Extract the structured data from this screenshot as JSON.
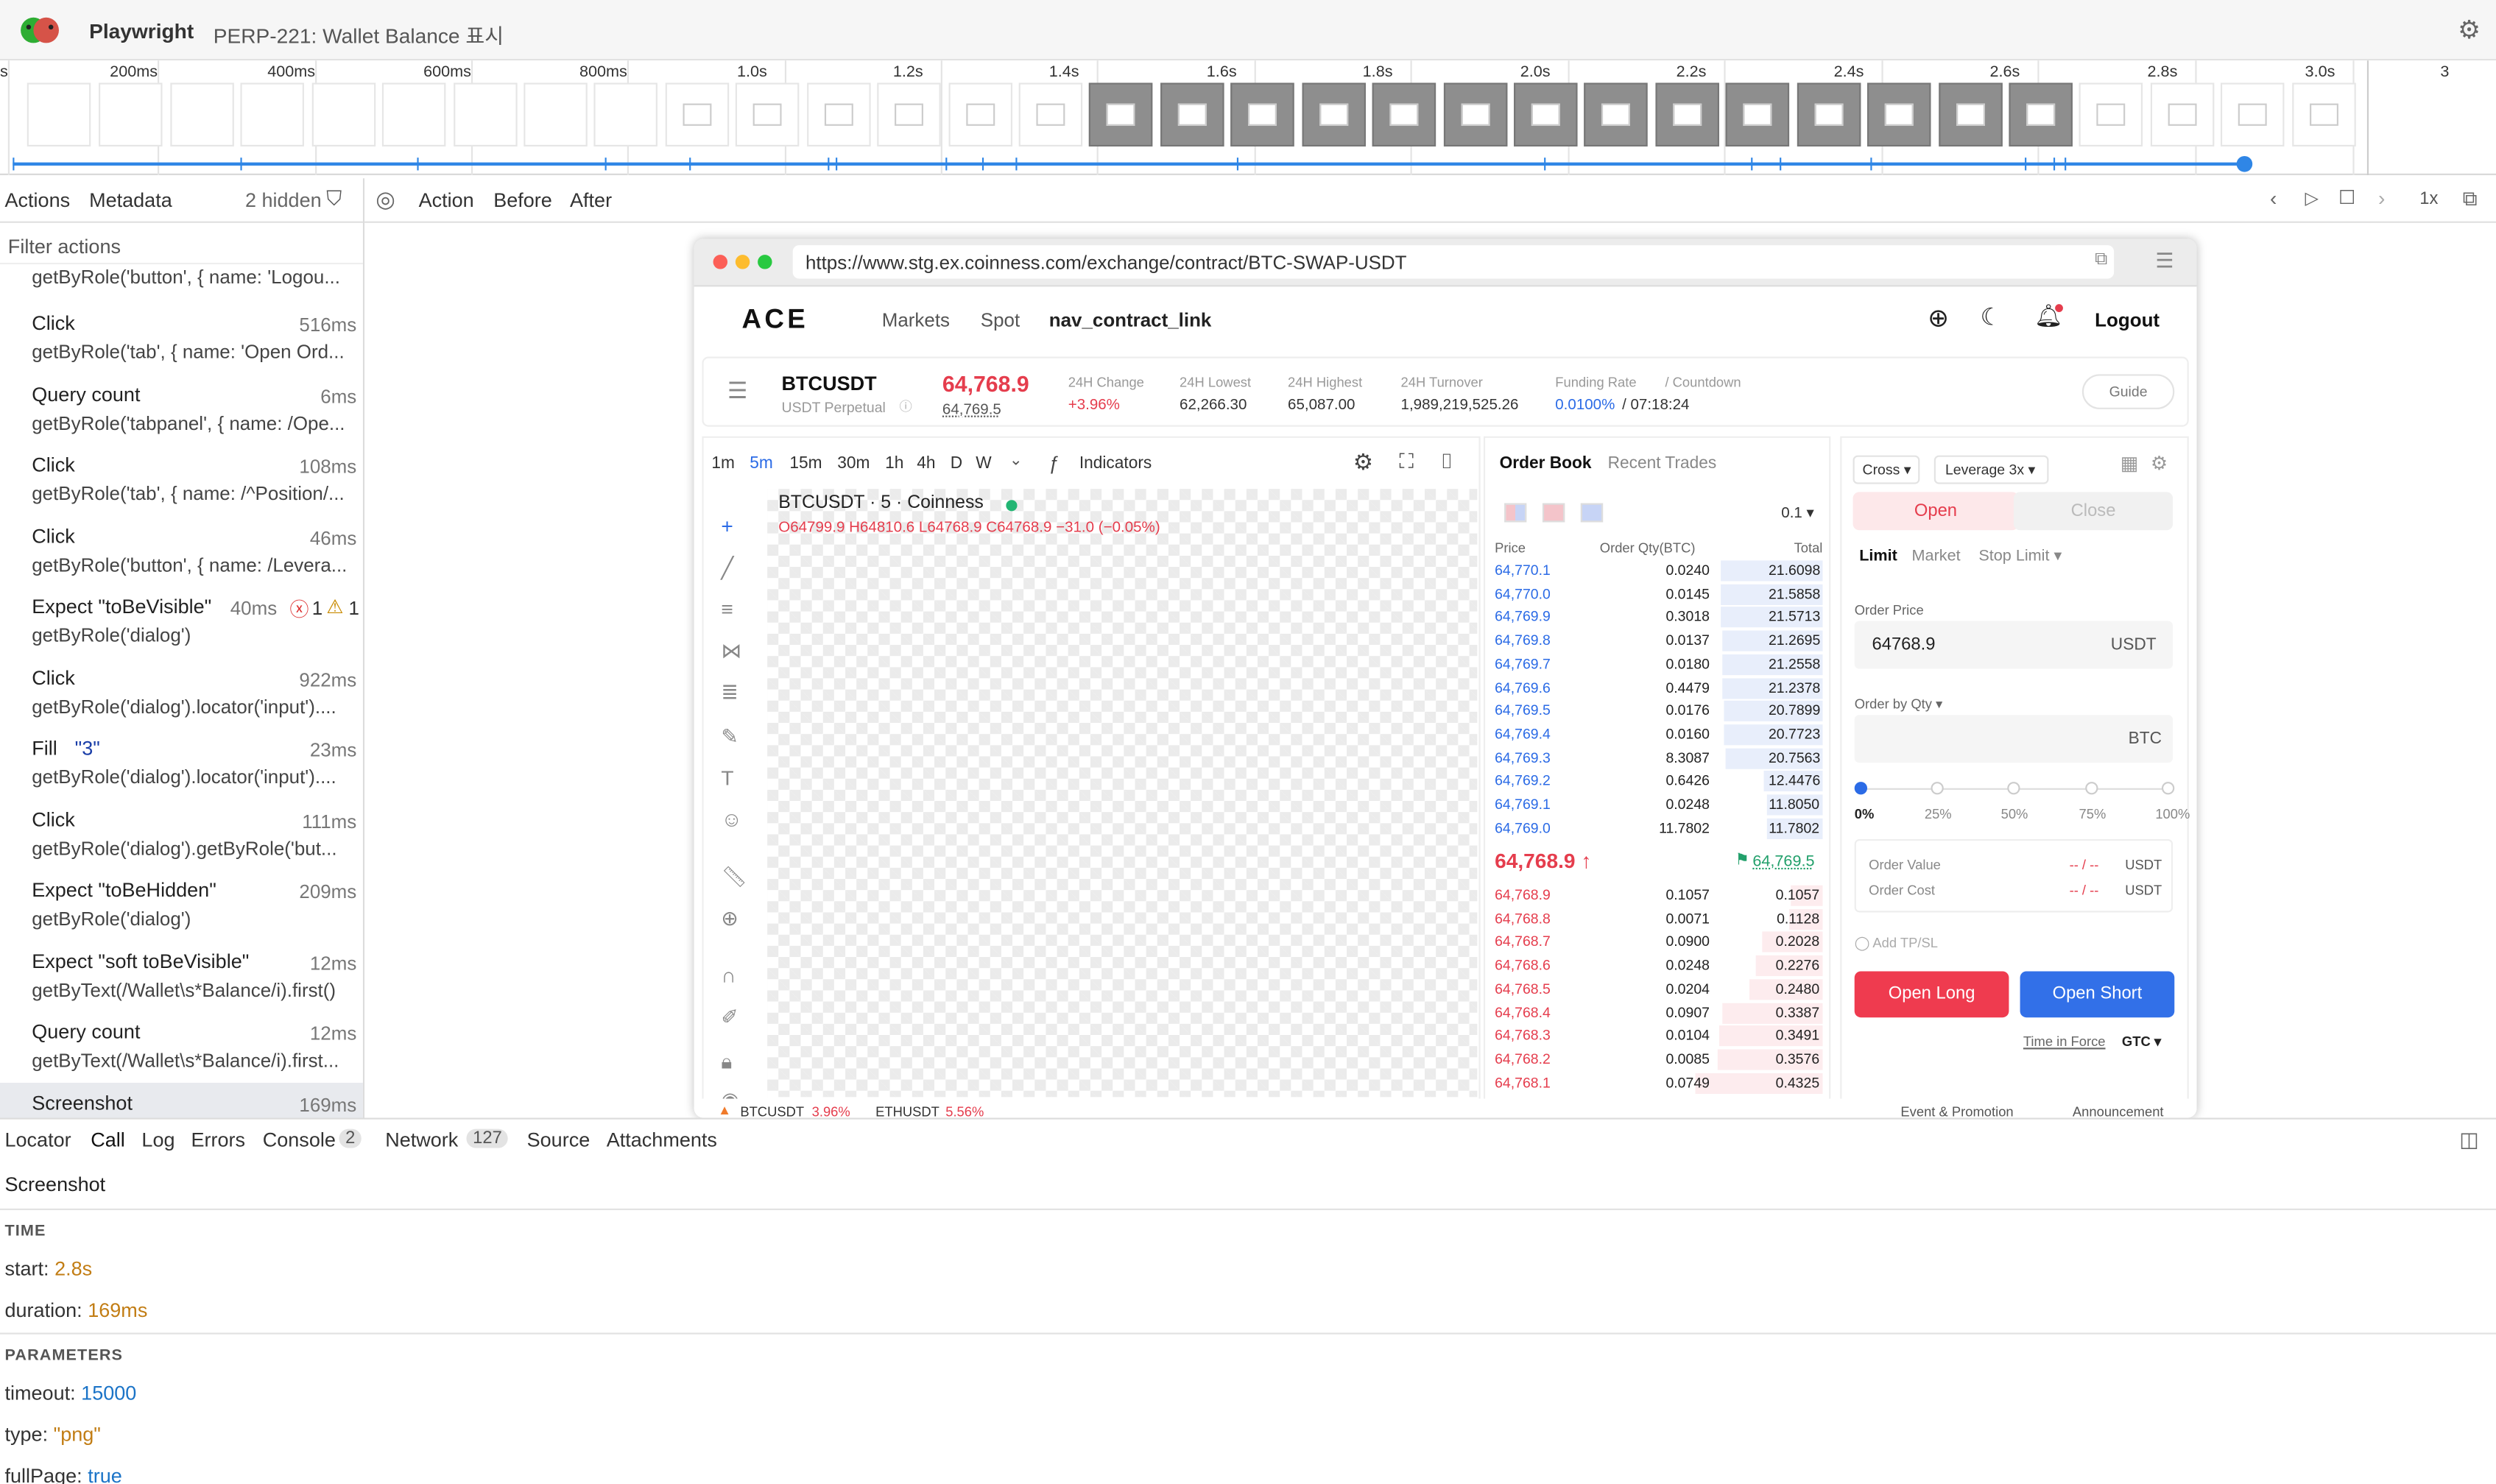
{
  "app": {
    "name": "Playwright",
    "title": "PERP-221: Wallet Balance 표시"
  },
  "timeline": {
    "labels": [
      "s",
      "200ms",
      "400ms",
      "600ms",
      "800ms",
      "1.0s",
      "1.2s",
      "1.4s",
      "1.6s",
      "1.8s",
      "2.0s",
      "2.2s",
      "2.4s",
      "2.6s",
      "2.8s",
      "3.0s",
      "3"
    ]
  },
  "sidebar": {
    "tabs": {
      "actions": "Actions",
      "metadata": "Metadata",
      "hidden": "2 hidden"
    },
    "filter_placeholder": "Filter actions",
    "first_sub": "getByRole('button', { name: 'Logou...",
    "actions": [
      {
        "title": "Click",
        "duration": "516ms",
        "sub": "getByRole('tab', { name: 'Open Ord..."
      },
      {
        "title": "Query count",
        "duration": "6ms",
        "sub": "getByRole('tabpanel', { name: /Ope..."
      },
      {
        "title": "Click",
        "duration": "108ms",
        "sub": "getByRole('tab', { name: /^Position/..."
      },
      {
        "title": "Click",
        "duration": "46ms",
        "sub": "getByRole('button', { name: /Levera..."
      },
      {
        "title": "Expect \"toBeVisible\"",
        "duration": "40ms",
        "sub": "getByRole('dialog')",
        "errors": "1",
        "warnings": "1"
      },
      {
        "title": "Click",
        "duration": "922ms",
        "sub": "getByRole('dialog').locator('input')...."
      },
      {
        "title": "Fill",
        "title_value": "\"3\"",
        "duration": "23ms",
        "sub": "getByRole('dialog').locator('input')...."
      },
      {
        "title": "Click",
        "duration": "111ms",
        "sub": "getByRole('dialog').getByRole('but..."
      },
      {
        "title": "Expect \"toBeHidden\"",
        "duration": "209ms",
        "sub": "getByRole('dialog')"
      },
      {
        "title": "Expect \"soft toBeVisible\"",
        "duration": "12ms",
        "sub": "getByText(/Wallet\\s*Balance/i).first()"
      },
      {
        "title": "Query count",
        "duration": "12ms",
        "sub": "getByText(/Wallet\\s*Balance/i).first..."
      },
      {
        "title": "Screenshot",
        "duration": "169ms",
        "sub": ""
      }
    ]
  },
  "snapshot_tabs": {
    "action": "Action",
    "before": "Before",
    "after": "After",
    "speed": "1x"
  },
  "browser": {
    "url": "https://www.stg.ex.coinness.com/exchange/contract/BTC-SWAP-USDT",
    "nav": {
      "logo": "ACE",
      "markets": "Markets",
      "spot": "Spot",
      "contract": "nav_contract_link",
      "logout": "Logout"
    },
    "ticker": {
      "symbol": "BTCUSDT",
      "type": "USDT Perpetual",
      "price": "64,768.9",
      "mark": "64,769.5",
      "change_label": "24H Change",
      "change": "+3.96%",
      "low_label": "24H Lowest",
      "low": "62,266.30",
      "high_label": "24H Highest",
      "high": "65,087.00",
      "turnover_label": "24H Turnover",
      "turnover": "1,989,219,525.26",
      "funding_label": "Funding Rate",
      "countdown_label": "/ Countdown",
      "funding": "0.0100%",
      "countdown": "/ 07:18:24",
      "guide": "Guide"
    },
    "chart": {
      "intervals": [
        "1m",
        "5m",
        "15m",
        "30m",
        "1h",
        "4h",
        "D",
        "W"
      ],
      "indicators": "Indicators",
      "legend_title": "BTCUSDT · 5 · Coinness",
      "ohlc": "O64799.9 H64810.6 L64768.9 C64768.9 −31.0 (−0.05%)"
    },
    "orderbook": {
      "tab_book": "Order Book",
      "tab_trades": "Recent Trades",
      "precision": "0.1",
      "col_price": "Price",
      "col_qty": "Order Qty(BTC)",
      "col_total": "Total",
      "asks": [
        [
          "64,770.1",
          "0.0240",
          "21.6098"
        ],
        [
          "64,770.0",
          "0.0145",
          "21.5858"
        ],
        [
          "64,769.9",
          "0.3018",
          "21.5713"
        ],
        [
          "64,769.8",
          "0.0137",
          "21.2695"
        ],
        [
          "64,769.7",
          "0.0180",
          "21.2558"
        ],
        [
          "64,769.6",
          "0.4479",
          "21.2378"
        ],
        [
          "64,769.5",
          "0.0176",
          "20.7899"
        ],
        [
          "64,769.4",
          "0.0160",
          "20.7723"
        ],
        [
          "64,769.3",
          "8.3087",
          "20.7563"
        ],
        [
          "64,769.2",
          "0.6426",
          "12.4476"
        ],
        [
          "64,769.1",
          "0.0248",
          "11.8050"
        ],
        [
          "64,769.0",
          "11.7802",
          "11.7802"
        ]
      ],
      "last_price": "64,768.9 ↑",
      "mark_price": "64,769.5",
      "bids": [
        [
          "64,768.9",
          "0.1057",
          "0.1057"
        ],
        [
          "64,768.8",
          "0.0071",
          "0.1128"
        ],
        [
          "64,768.7",
          "0.0900",
          "0.2028"
        ],
        [
          "64,768.6",
          "0.0248",
          "0.2276"
        ],
        [
          "64,768.5",
          "0.0204",
          "0.2480"
        ],
        [
          "64,768.4",
          "0.0907",
          "0.3387"
        ],
        [
          "64,768.3",
          "0.0104",
          "0.3491"
        ],
        [
          "64,768.2",
          "0.0085",
          "0.3576"
        ],
        [
          "64,768.1",
          "0.0749",
          "0.4325"
        ]
      ]
    },
    "order": {
      "margin": "Cross",
      "leverage": "Leverage 3x",
      "open": "Open",
      "close": "Close",
      "limit": "Limit",
      "market": "Market",
      "stop_limit": "Stop Limit",
      "price_label": "Order Price",
      "price_value": "64768.9",
      "price_unit": "USDT",
      "qty_label": "Order by Qty",
      "qty_unit": "BTC",
      "pcts": [
        "0%",
        "25%",
        "50%",
        "75%",
        "100%"
      ],
      "value_label": "Order Value",
      "cost_label": "Order Cost",
      "dash": "-- / --",
      "usdt": "USDT",
      "tpsl": "Add TP/SL",
      "open_long": "Open Long",
      "open_short": "Open Short",
      "tif": "Time in Force",
      "gtc": "GTC"
    },
    "footer": {
      "ticker1": "BTCUSDT",
      "t1change": "3.96%",
      "ticker2": "ETHUSDT",
      "t2change": "5.56%",
      "event": "Event & Promotion",
      "announce": "Announcement"
    }
  },
  "bottom": {
    "tabs": [
      "Locator",
      "Call",
      "Log",
      "Errors",
      "Console",
      "Network",
      "Source",
      "Attachments"
    ],
    "console_count": "2",
    "network_count": "127",
    "title": "Screenshot",
    "time_hdr": "TIME",
    "start_label": "start:",
    "start": "2.8s",
    "dur_label": "duration:",
    "dur": "169ms",
    "params_hdr": "PARAMETERS",
    "timeout_label": "timeout:",
    "timeout": "15000",
    "type_label": "type:",
    "type": "\"png\"",
    "full_label": "fullPage:",
    "full": "true"
  }
}
